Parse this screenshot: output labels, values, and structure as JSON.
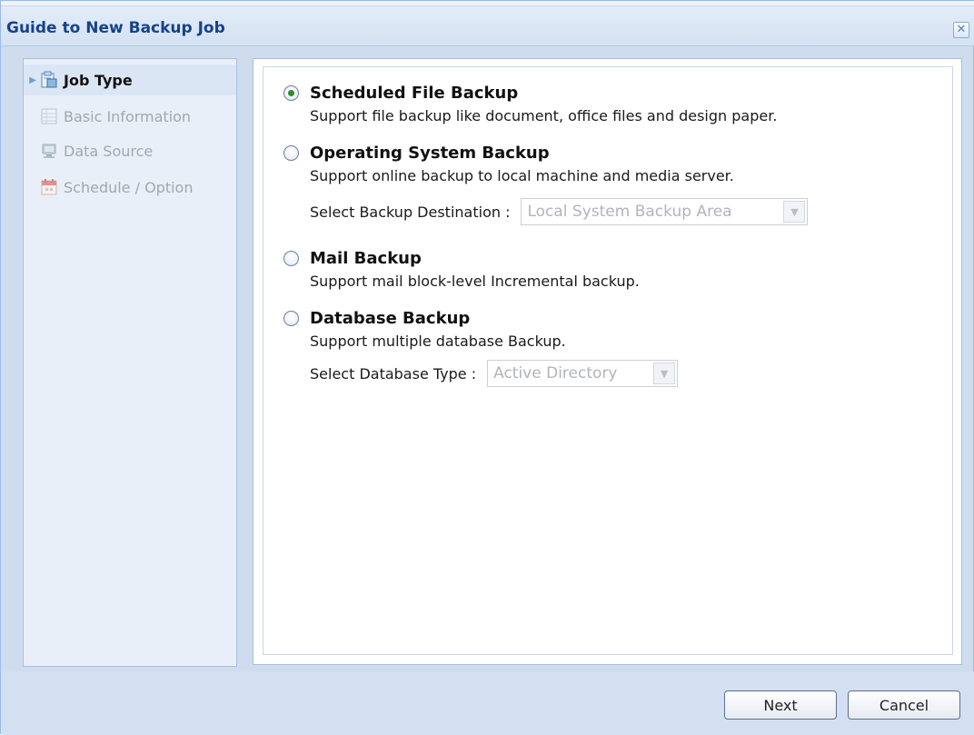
{
  "window": {
    "title": "Guide to New Backup Job",
    "close_glyph": "✕"
  },
  "steps": [
    {
      "label": "Job Type",
      "icon": "job-type-icon",
      "active": true
    },
    {
      "label": "Basic Information",
      "icon": "basic-information-icon",
      "active": false
    },
    {
      "label": "Data Source",
      "icon": "data-source-icon",
      "active": false
    },
    {
      "label": "Schedule / Option",
      "icon": "calendar-icon",
      "active": false
    }
  ],
  "options": [
    {
      "title": "Scheduled File Backup",
      "description": "Support file backup like document, office files and design paper.",
      "checked": true
    },
    {
      "title": "Operating System Backup",
      "description": "Support online backup to local machine and media server.",
      "checked": false,
      "select_label": "Select Backup Destination :",
      "select_value": "Local System Backup Area"
    },
    {
      "title": "Mail Backup",
      "description": "Support mail block-level Incremental backup.",
      "checked": false
    },
    {
      "title": "Database Backup",
      "description": "Support multiple database Backup.",
      "checked": false,
      "select_label": "Select Database Type :",
      "select_value": "Active Directory"
    }
  ],
  "footer": {
    "next_label": "Next",
    "cancel_label": "Cancel"
  },
  "colors": {
    "title_text": "#15428b",
    "window_bg": "#cfdcee",
    "radio_selected": "#2f8a2f"
  }
}
